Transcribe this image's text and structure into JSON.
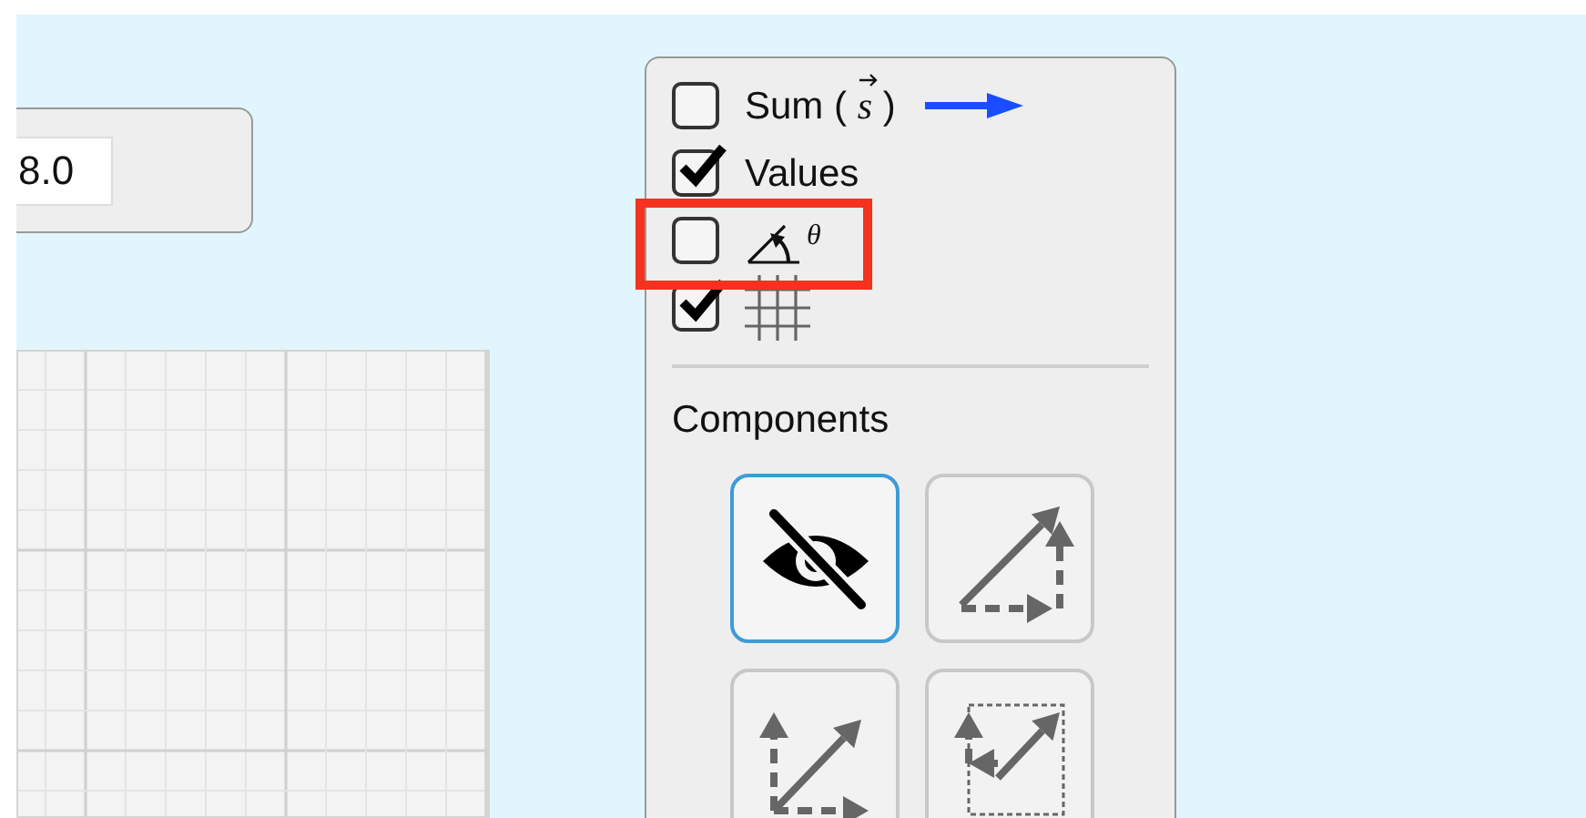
{
  "magnitude_field": {
    "value": "8.0"
  },
  "options": [
    {
      "kind": "sum",
      "label": "Sum (",
      "symbol": "s",
      "suffix": ")",
      "checked": false,
      "highlighted": false
    },
    {
      "kind": "values",
      "label": "Values",
      "checked": true,
      "highlighted": false
    },
    {
      "kind": "angle",
      "symbol": "θ",
      "checked": false,
      "highlighted": true
    },
    {
      "kind": "grid",
      "checked": true,
      "highlighted": false
    }
  ],
  "components": {
    "title": "Components",
    "buttons": [
      {
        "kind": "hidden",
        "selected": true
      },
      {
        "kind": "triangle",
        "selected": false
      },
      {
        "kind": "parallelogram",
        "selected": false
      },
      {
        "kind": "projection",
        "selected": false
      }
    ]
  }
}
